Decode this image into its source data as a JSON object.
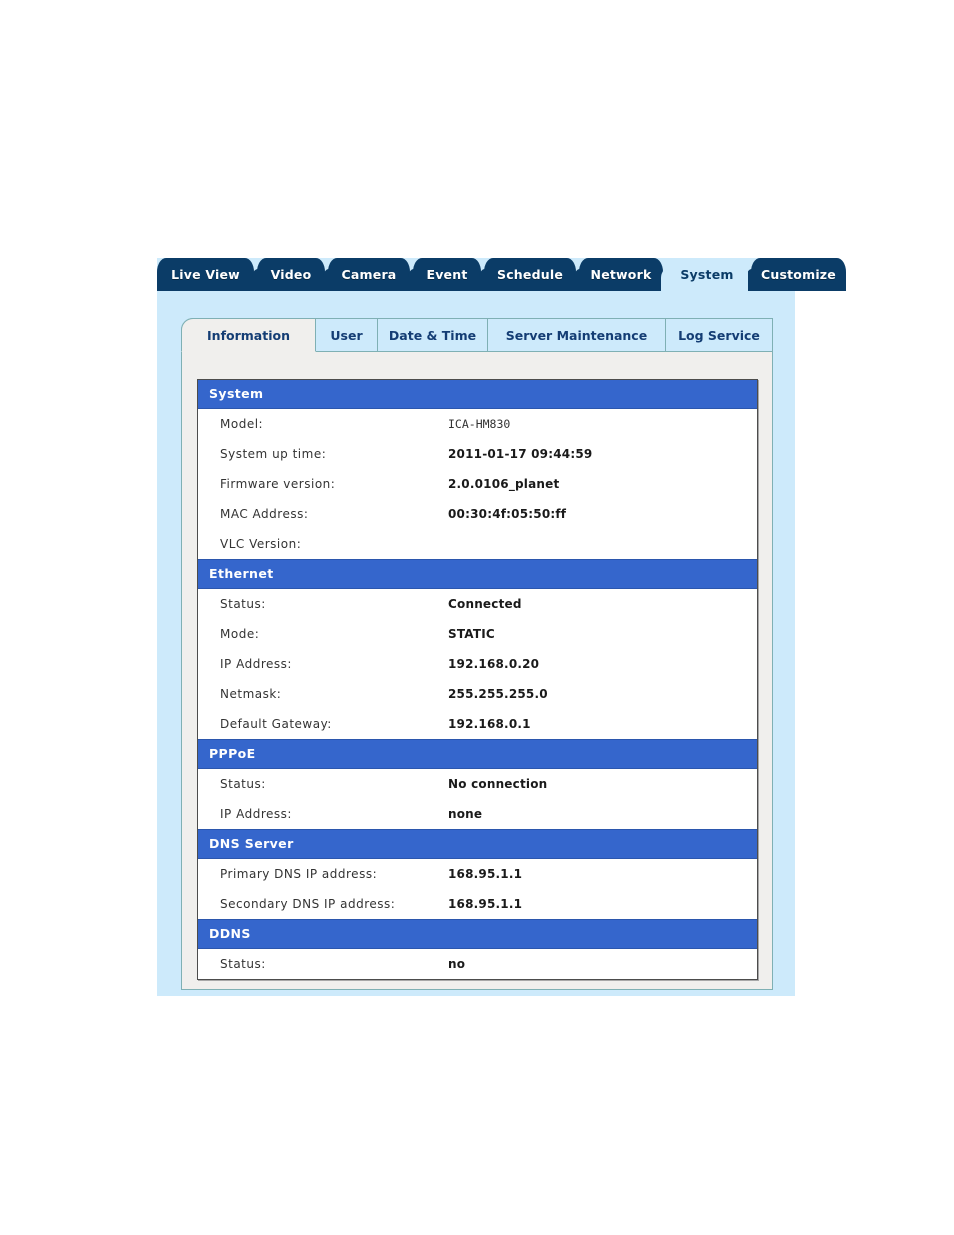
{
  "theme": {
    "outer_panel_bg": "#cdeafb",
    "main_tab_bg": "#0b3c67",
    "main_tab_text": "#ffffff",
    "sub_tab_bg": "#cdeafb",
    "sub_tab_text": "#143d74",
    "sub_panel_bg": "#f0efed",
    "section_header_bg": "#3566cc",
    "section_header_text": "#ffffff",
    "border": "#7fb0b4",
    "table_border": "#4c4c4c"
  },
  "main_tabs": [
    {
      "label": "Live View",
      "selected": false
    },
    {
      "label": "Video",
      "selected": false
    },
    {
      "label": "Camera",
      "selected": false
    },
    {
      "label": "Event",
      "selected": false
    },
    {
      "label": "Schedule",
      "selected": false
    },
    {
      "label": "Network",
      "selected": false
    },
    {
      "label": "System",
      "selected": true
    },
    {
      "label": "Customize",
      "selected": false
    }
  ],
  "sub_tabs": [
    {
      "label": "Information",
      "selected": true
    },
    {
      "label": "User",
      "selected": false
    },
    {
      "label": "Date & Time",
      "selected": false
    },
    {
      "label": "Server Maintenance",
      "selected": false
    },
    {
      "label": "Log Service",
      "selected": false
    }
  ],
  "sections": [
    {
      "title": "System",
      "rows": [
        {
          "label": "Model:",
          "value": "ICA-HM830",
          "style": "plain"
        },
        {
          "label": "System up time:",
          "value": "2011-01-17 09:44:59",
          "style": "bold"
        },
        {
          "label": "Firmware version:",
          "value": "2.0.0106_planet",
          "style": "bold"
        },
        {
          "label": "MAC Address:",
          "value": "00:30:4f:05:50:ff",
          "style": "bold"
        },
        {
          "label": "VLC Version:",
          "value": "",
          "style": "bold"
        }
      ]
    },
    {
      "title": "Ethernet",
      "rows": [
        {
          "label": "Status:",
          "value": "Connected",
          "style": "bold"
        },
        {
          "label": "Mode:",
          "value": "STATIC",
          "style": "bold"
        },
        {
          "label": "IP Address:",
          "value": "192.168.0.20",
          "style": "bold"
        },
        {
          "label": "Netmask:",
          "value": "255.255.255.0",
          "style": "bold"
        },
        {
          "label": "Default Gateway:",
          "value": "192.168.0.1",
          "style": "bold"
        }
      ]
    },
    {
      "title": "PPPoE",
      "rows": [
        {
          "label": "Status:",
          "value": "No connection",
          "style": "bold"
        },
        {
          "label": "IP Address:",
          "value": "none",
          "style": "bold"
        }
      ]
    },
    {
      "title": "DNS Server",
      "rows": [
        {
          "label": "Primary DNS IP address:",
          "value": "168.95.1.1",
          "style": "bold"
        },
        {
          "label": "Secondary DNS IP address:",
          "value": "168.95.1.1",
          "style": "bold"
        }
      ]
    },
    {
      "title": "DDNS",
      "rows": [
        {
          "label": "Status:",
          "value": "no",
          "style": "bold"
        }
      ]
    }
  ]
}
